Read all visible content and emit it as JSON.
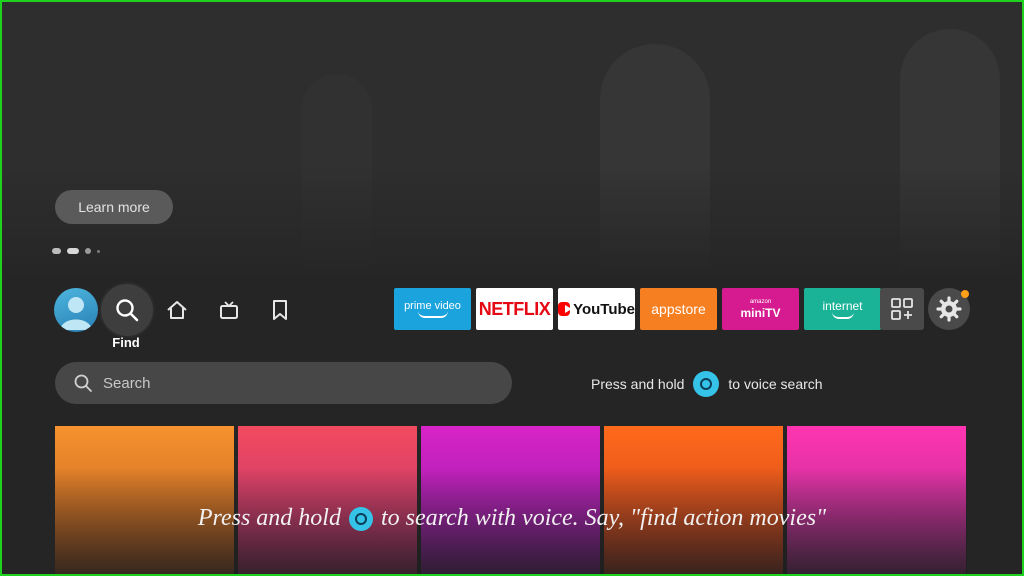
{
  "hero": {
    "learn_more_label": "Learn more",
    "carousel_dots": 4
  },
  "nav": {
    "profile": "profile-icon",
    "find_label": "Find",
    "home": "home-icon",
    "live_tv": "live-tv-icon",
    "watchlist": "bookmark-icon"
  },
  "apps": [
    {
      "name": "prime video",
      "color": "#1aa3dc"
    },
    {
      "name": "NETFLIX",
      "color": "#ffffff"
    },
    {
      "name": "YouTube",
      "color": "#ffffff"
    },
    {
      "name": "appstore",
      "color": "#f67f22"
    },
    {
      "name": "miniTV",
      "color": "#d61a8f"
    },
    {
      "name": "internet",
      "color": "#1ab398"
    }
  ],
  "minitv_brand": "amazon",
  "search": {
    "placeholder": "Search"
  },
  "voice": {
    "prefix": "Press and hold",
    "suffix": "to voice search"
  },
  "caption": {
    "prefix": "Press and hold",
    "suffix": "to search with voice. Say, \"find action movies\""
  },
  "colors": {
    "frame": "#1fd11f",
    "alexa": "#35c3e8",
    "notification": "#ff9f1a"
  }
}
